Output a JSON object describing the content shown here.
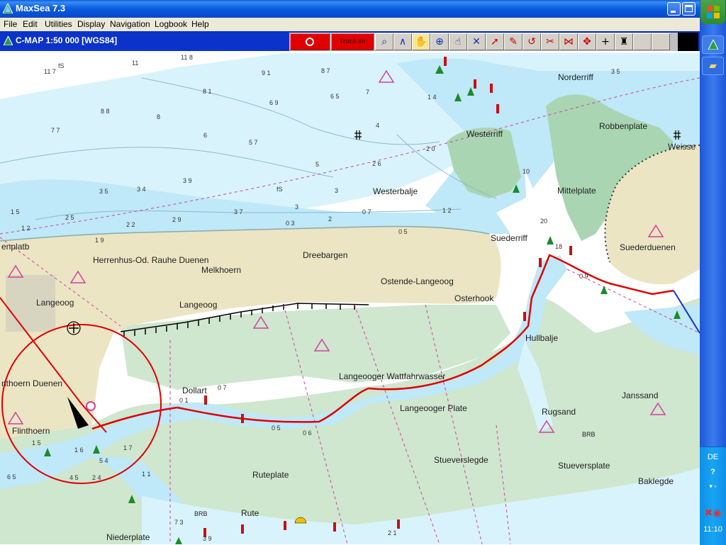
{
  "window": {
    "title": "MaxSea 7.3"
  },
  "menu": [
    "File",
    "Edit",
    "Utilities",
    "Display",
    "Navigation",
    "Logbook",
    "Help"
  ],
  "chart_label": "C-MAP 1:50 000 [WGS84]",
  "toolbar": {
    "track_label": "Track on"
  },
  "places": {
    "norderriff": "Norderriff",
    "robbenplate": "Robbenplate",
    "weisse": "Weisse",
    "westerriff": "Westerriff",
    "mittelplate": "Mittelplate",
    "westerbalje": "Westerbalje",
    "suederriff": "Suederriff",
    "suederduenen": "Suederduenen",
    "enplatb": "enplatb",
    "herrenhus": "Herrenhus-Od. Rauhe Duenen",
    "melkhoern": "Melkhoern",
    "dreebargen": "Dreebargen",
    "ostende": "Ostende-Langeoog",
    "osterhook": "Osterhook",
    "langeoog_village": "Langeoog",
    "langeoog_island": "Langeoog",
    "hullbalje": "Hullbalje",
    "wattfahrwasser": "Langeooger Wattfahrwasser",
    "dollart": "Dollart",
    "flinthoern_duenen": "nthoern Duenen",
    "flinthoern": "Flinthoern",
    "langeooger_plate": "Langeooger Plate",
    "rugsand": "Rugsand",
    "brb1": "BRB",
    "janssand": "Janssand",
    "stueverslegde": "Stueverslegde",
    "stueversplate": "Stueversplate",
    "baklegde": "Baklegde",
    "ruteplate": "Ruteplate",
    "rute": "Rute",
    "brb2": "BRB",
    "niederplate": "Niederplate"
  },
  "depths": [
    "11",
    "11 8",
    "11 7",
    "fS",
    "9 1",
    "8 7",
    "8 1",
    "6 5",
    "6 9",
    "7",
    "8 8",
    "8",
    "7 7",
    "6",
    "5 7",
    "5",
    "3 9",
    "fS",
    "3",
    "4",
    "3 5",
    "3 4",
    "2 5",
    "2 2",
    "2 9",
    "3 7",
    "2 6",
    "2",
    "3",
    "0 7",
    "0 3",
    "0 5",
    "1 9",
    "1 5",
    "1 2",
    "2 0",
    "20",
    "18",
    "10",
    "1 4",
    "0 9",
    "3 5",
    "0 7",
    "0 1",
    "1 7",
    "1 6",
    "1 5",
    "7 3",
    "4 5",
    "2 4",
    "1 1",
    "5 4",
    "3 9",
    "2 1",
    "6 5",
    "0 6",
    "0 5",
    "1 2"
  ],
  "taskbar": {
    "lang": "DE",
    "help": "?",
    "clock": "11:10"
  }
}
